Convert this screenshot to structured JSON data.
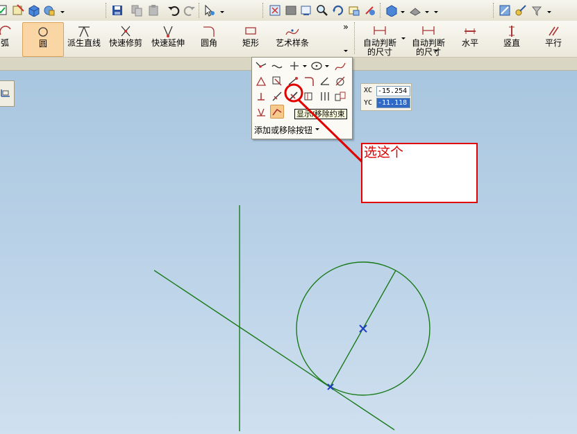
{
  "toolbar": {
    "arc_label": "弧",
    "circle_label": "圆",
    "derived_line_label": "派生直线",
    "quick_trim_label": "快速修剪",
    "quick_extend_label": "快速延伸",
    "fillet_label": "圆角",
    "rectangle_label": "矩形",
    "studio_spline_label": "艺术样条",
    "auto_dim1_line1": "自动判断",
    "auto_dim1_line2": "的尺寸",
    "auto_dim2_line1": "自动判断",
    "auto_dim2_line2": "的尺寸",
    "horizontal_label": "水平",
    "vertical_label": "竖直",
    "parallel_label": "平行",
    "more_glyph": "»"
  },
  "palette": {
    "tooltip": "显示/移除约束",
    "add_remove_label": "添加或移除按钮"
  },
  "coords": {
    "xc_label": "XC",
    "xc_value": "-15.254",
    "yc_label": "YC",
    "yc_value": "-11.118"
  },
  "annotation": {
    "text": "选这个"
  },
  "colors": {
    "sketch_green": "#1a7a1a",
    "point_blue": "#1f3fbf",
    "annotation_red": "#e00000",
    "selected_tool": "#fbd6a5"
  }
}
